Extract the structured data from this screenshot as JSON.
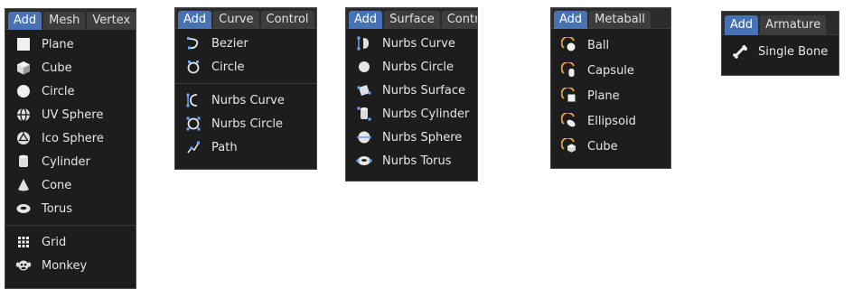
{
  "colors": {
    "panel_bg": "#1d1d1d",
    "header_bg": "#2b2b2b",
    "active_tab": "#4772b3",
    "text": "#e6e6e6",
    "icon_orange": "#e8a33a",
    "icon_blue": "#6aa7ff"
  },
  "panels": {
    "mesh": {
      "tabs": [
        "Add",
        "Mesh",
        "Vertex"
      ],
      "items": [
        {
          "label": "Plane",
          "icon": "plane-icon"
        },
        {
          "label": "Cube",
          "icon": "cube-icon"
        },
        {
          "label": "Circle",
          "icon": "circle-icon"
        },
        {
          "label": "UV Sphere",
          "icon": "uv-sphere-icon"
        },
        {
          "label": "Ico Sphere",
          "icon": "ico-sphere-icon"
        },
        {
          "label": "Cylinder",
          "icon": "cylinder-icon"
        },
        {
          "label": "Cone",
          "icon": "cone-icon"
        },
        {
          "label": "Torus",
          "icon": "torus-icon"
        },
        {
          "label": "Grid",
          "icon": "grid-icon"
        },
        {
          "label": "Monkey",
          "icon": "monkey-icon"
        }
      ]
    },
    "curve": {
      "tabs": [
        "Add",
        "Curve",
        "Control"
      ],
      "items": [
        {
          "label": "Bezier",
          "icon": "bezier-icon"
        },
        {
          "label": "Circle",
          "icon": "curve-circle-icon"
        },
        {
          "label": "Nurbs Curve",
          "icon": "nurbs-curve-icon"
        },
        {
          "label": "Nurbs Circle",
          "icon": "nurbs-circle-icon"
        },
        {
          "label": "Path",
          "icon": "path-icon"
        }
      ]
    },
    "surface": {
      "tabs": [
        "Add",
        "Surface",
        "Control P"
      ],
      "items": [
        {
          "label": "Nurbs Curve",
          "icon": "surface-curve-icon"
        },
        {
          "label": "Nurbs Circle",
          "icon": "surface-circle-icon"
        },
        {
          "label": "Nurbs Surface",
          "icon": "surface-patch-icon"
        },
        {
          "label": "Nurbs Cylinder",
          "icon": "surface-cylinder-icon"
        },
        {
          "label": "Nurbs Sphere",
          "icon": "surface-sphere-icon"
        },
        {
          "label": "Nurbs Torus",
          "icon": "surface-torus-icon"
        }
      ]
    },
    "metaball": {
      "tabs": [
        "Add",
        "Metaball"
      ],
      "items": [
        {
          "label": "Ball",
          "icon": "meta-ball-icon"
        },
        {
          "label": "Capsule",
          "icon": "meta-capsule-icon"
        },
        {
          "label": "Plane",
          "icon": "meta-plane-icon"
        },
        {
          "label": "Ellipsoid",
          "icon": "meta-ellipsoid-icon"
        },
        {
          "label": "Cube",
          "icon": "meta-cube-icon"
        }
      ]
    },
    "armature": {
      "tabs": [
        "Add",
        "Armature"
      ],
      "items": [
        {
          "label": "Single Bone",
          "icon": "bone-icon"
        }
      ]
    }
  }
}
